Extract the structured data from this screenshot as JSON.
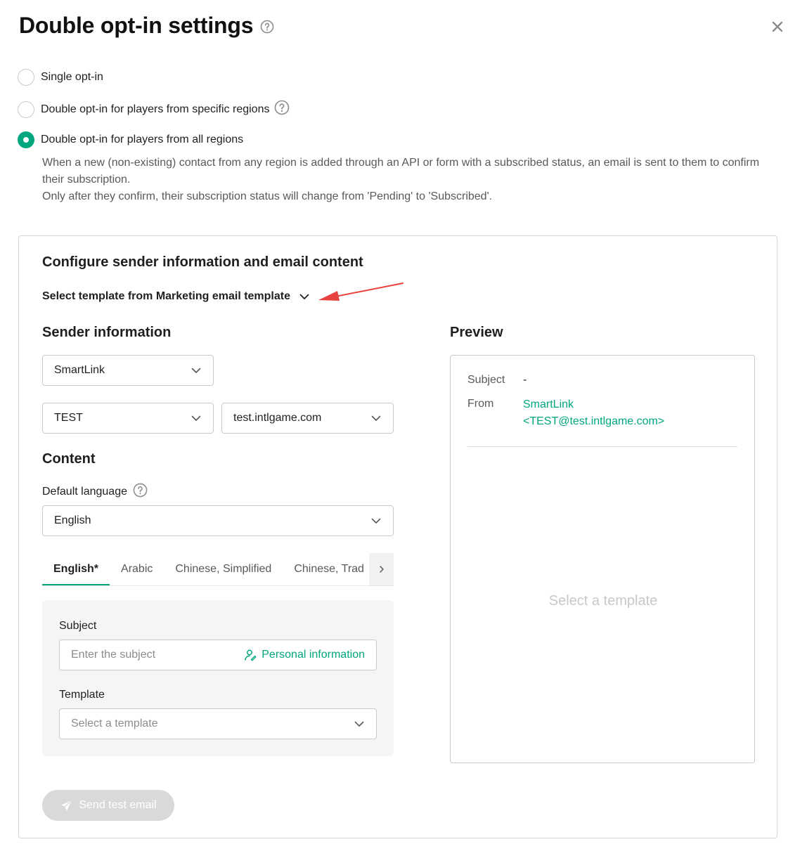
{
  "dialog": {
    "title": "Double opt-in settings",
    "options": [
      {
        "label": "Single opt-in",
        "checked": false
      },
      {
        "label": "Double opt-in for players from specific regions",
        "checked": false
      },
      {
        "label": "Double opt-in for players from all regions",
        "checked": true
      }
    ],
    "description_line1": "When a new (non-existing) contact from any region is added through an API or form with a subscribed status, an email is sent to them to confirm their subscription.",
    "description_line2": "Only after they confirm, their subscription status will change from 'Pending' to 'Subscribed'."
  },
  "config": {
    "title": "Configure sender information and email content",
    "template_source_label": "Select template from Marketing email template",
    "sender_heading": "Sender information",
    "sender_name": "SmartLink",
    "sender_prefix": "TEST",
    "sender_domain": "test.intlgame.com",
    "content_heading": "Content",
    "default_language_label": "Default language",
    "default_language": "English",
    "language_tabs": [
      "English*",
      "Arabic",
      "Chinese, Simplified",
      "Chinese, Trad"
    ],
    "subject_label": "Subject",
    "subject_placeholder": "Enter the subject",
    "personal_info_label": "Personal information",
    "template_label": "Template",
    "template_placeholder": "Select a template",
    "send_test_label": "Send test email"
  },
  "preview": {
    "heading": "Preview",
    "subject_key": "Subject",
    "subject_value": "-",
    "from_key": "From",
    "from_name": "SmartLink",
    "from_address": "<TEST@test.intlgame.com>",
    "empty_state": "Select a template"
  },
  "colors": {
    "accent": "#00a67e",
    "annotation_arrow": "#e8423f"
  }
}
